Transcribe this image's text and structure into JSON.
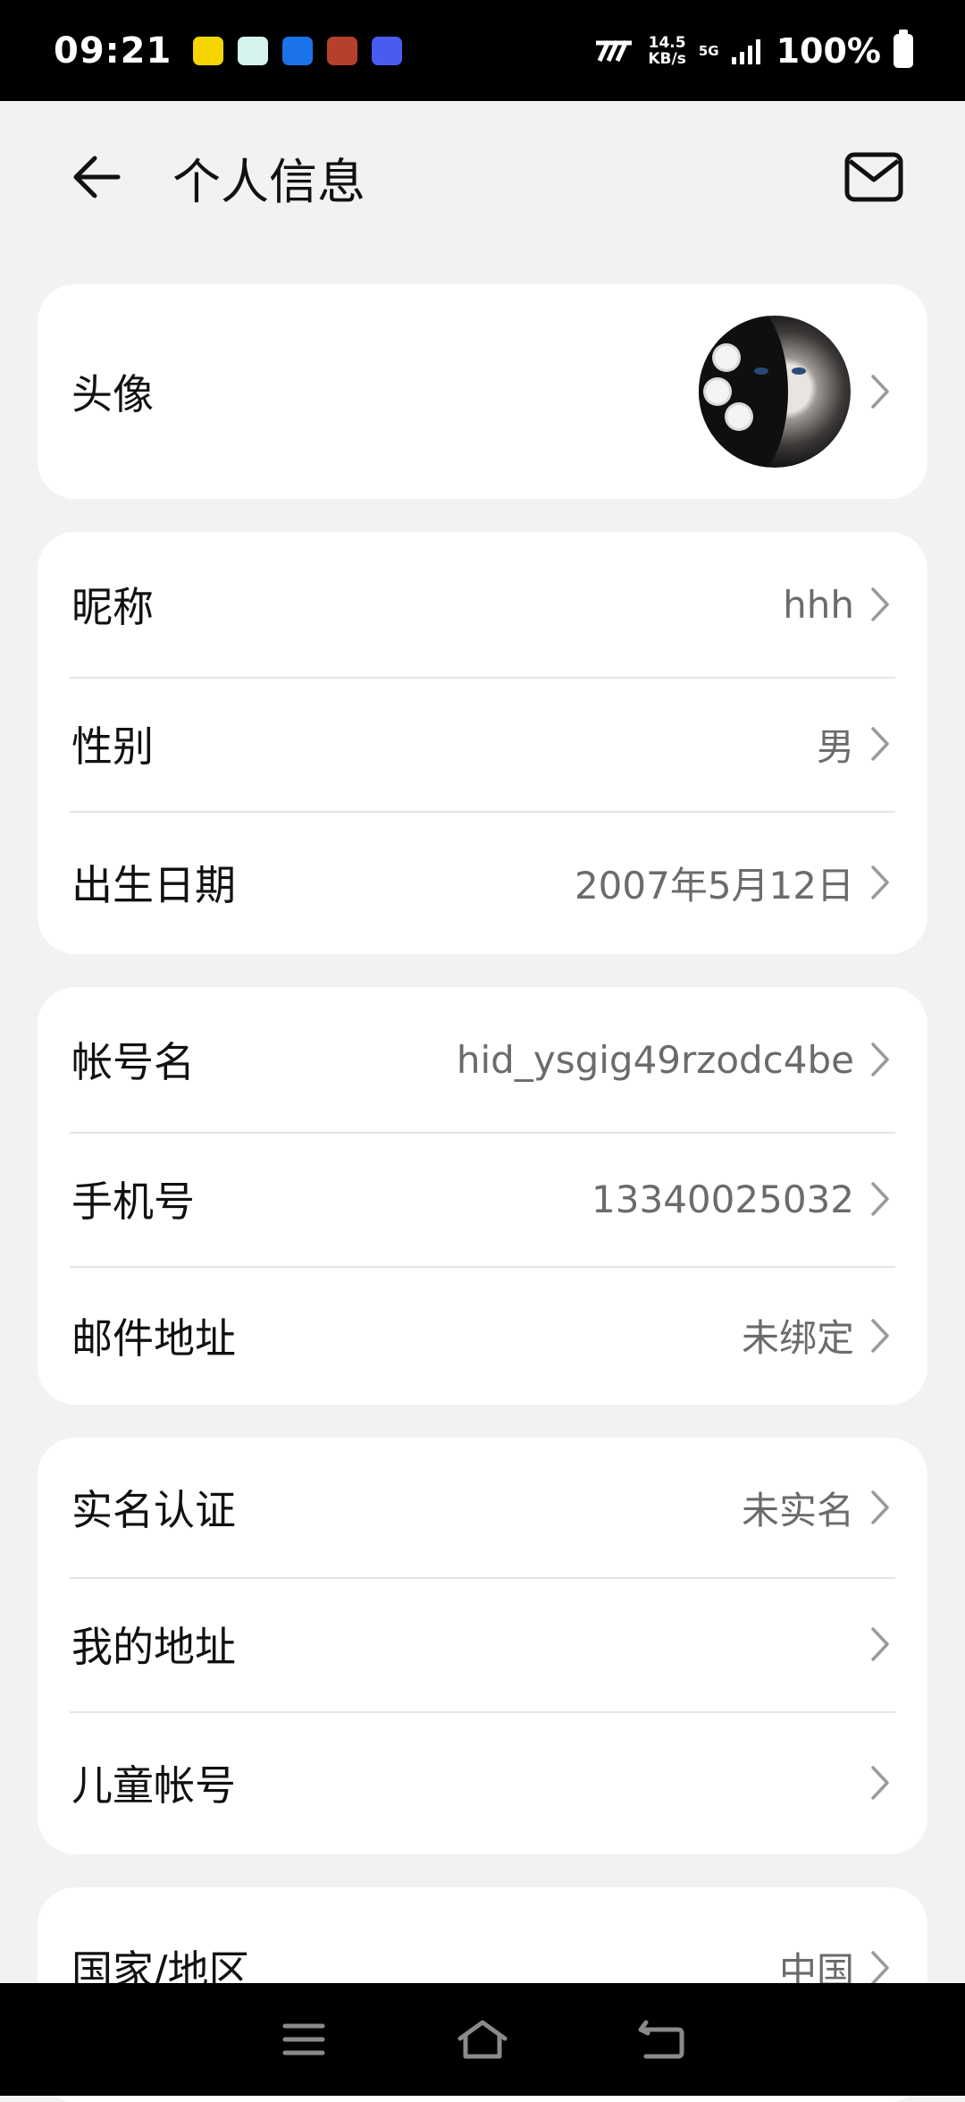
{
  "status_bar": {
    "time": "09:21",
    "net_speed_value": "14.5",
    "net_speed_unit": "KB/s",
    "network_type": "5G",
    "battery": "100%"
  },
  "header": {
    "title": "个人信息"
  },
  "profile": {
    "avatar_label": "头像"
  },
  "basic": [
    {
      "label": "昵称",
      "value": "hhh"
    },
    {
      "label": "性别",
      "value": "男"
    },
    {
      "label": "出生日期",
      "value": "2007年5月12日"
    }
  ],
  "account": [
    {
      "label": "帐号名",
      "value": "hid_ysgig49rzodc4be"
    },
    {
      "label": "手机号",
      "value": "13340025032"
    },
    {
      "label": "邮件地址",
      "value": "未绑定"
    }
  ],
  "identity": [
    {
      "label": "实名认证",
      "value": "未实名"
    },
    {
      "label": "我的地址",
      "value": ""
    },
    {
      "label": "儿童帐号",
      "value": ""
    }
  ],
  "region": [
    {
      "label": "国家/地区",
      "value": "中国"
    }
  ],
  "icons": {
    "back": "arrow-left-icon",
    "mail": "mail-icon",
    "chevron": "chevron-right-icon",
    "nav_menu": "menu-icon",
    "nav_home": "home-icon",
    "nav_back": "return-icon"
  }
}
